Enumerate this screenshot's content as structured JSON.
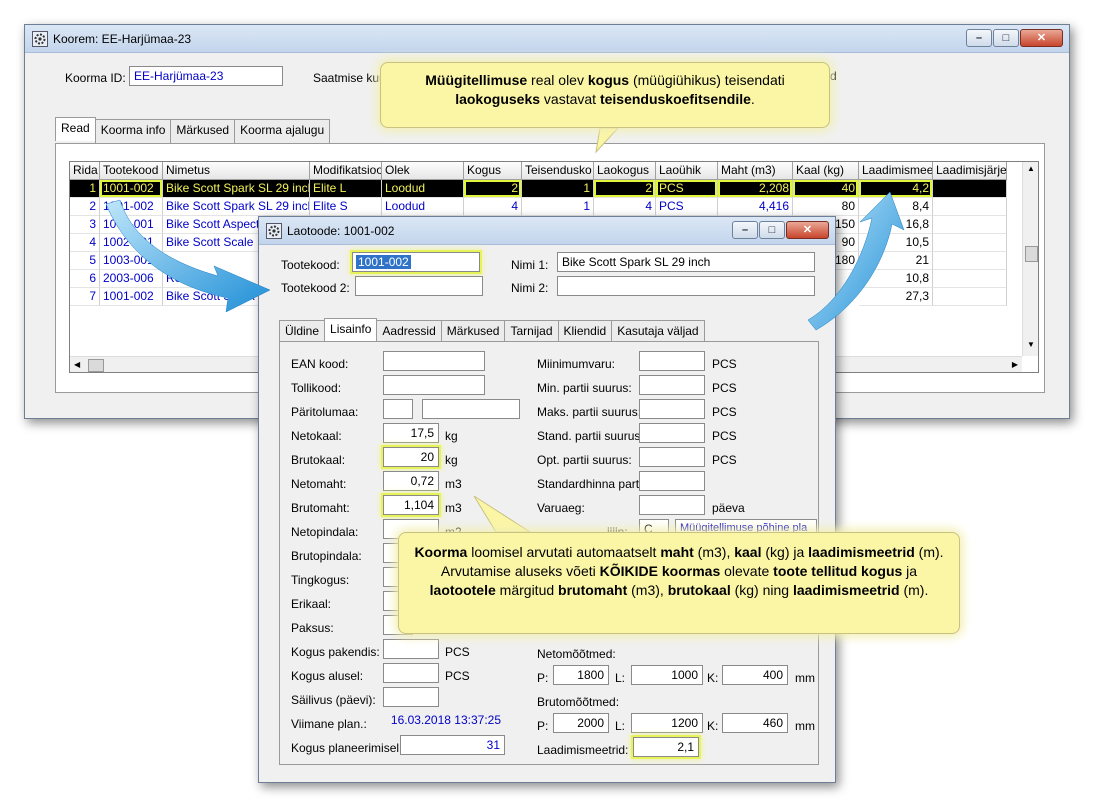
{
  "main": {
    "title": "Koorem: EE-Harjümaa-23",
    "id_label": "Koorma ID:",
    "id_value": "EE-Harjümaa-23",
    "saatmise_label": "Saatmise kuu",
    "truncated_right": "d",
    "tabs": [
      "Read",
      "Koorma info",
      "Märkused",
      "Koorma ajalugu"
    ],
    "grid": {
      "headers": [
        "Rida",
        "Tootekood",
        "Nimetus",
        "Modifikatsioo",
        "Olek",
        "Kogus",
        "Teisendusko",
        "Laokogus",
        "Laoühik",
        "Maht (m3)",
        "Kaal (kg)",
        "Laadimismee",
        "Laadimisjärjel"
      ],
      "rows": [
        [
          "1",
          "1001-002",
          "Bike Scott Spark SL 29 inch",
          "Elite L",
          "Loodud",
          "2",
          "1",
          "2",
          "PCS",
          "2,208",
          "40",
          "4,2"
        ],
        [
          "2",
          "1001-002",
          "Bike Scott Spark SL 29 inch",
          "Elite S",
          "Loodud",
          "4",
          "1",
          "4",
          "PCS",
          "4,416",
          "80",
          "8,4"
        ],
        [
          "3",
          "1004-001",
          "Bike Scott Aspect",
          "",
          "",
          "",
          "",
          "",
          "",
          "",
          "150",
          "16,8"
        ],
        [
          "4",
          "1002-001",
          "Bike Scott Scale",
          "",
          "",
          "",
          "",
          "",
          "",
          "",
          "90",
          "10,5"
        ],
        [
          "5",
          "1003-001",
          "",
          "",
          "",
          "",
          "",
          "",
          "",
          "",
          "180",
          "21"
        ],
        [
          "6",
          "2003-006",
          "Rear",
          "",
          "",
          "",
          "",
          "",
          "",
          "",
          "",
          "10,8"
        ],
        [
          "7",
          "1001-002",
          "Bike Scott Spark",
          "",
          "",
          "",
          "",
          "",
          "",
          "",
          "",
          "27,3"
        ]
      ]
    }
  },
  "detail": {
    "title": "Laotoode: 1001-002",
    "tootekood_label": "Tootekood:",
    "tootekood_value": "1001-002",
    "tootekood2_label": "Tootekood 2:",
    "nimi1_label": "Nimi 1:",
    "nimi1_value": "Bike Scott Spark SL 29 inch",
    "nimi2_label": "Nimi 2:",
    "tabs": [
      "Üldine",
      "Lisainfo",
      "Aadressid",
      "Märkused",
      "Tarnijad",
      "Kliendid",
      "Kasutaja väljad"
    ],
    "left_fields": [
      {
        "label": "EAN kood:",
        "value": "",
        "unit": ""
      },
      {
        "label": "Tollikood:",
        "value": "",
        "unit": ""
      },
      {
        "label": "Päritolumaa:",
        "value": "",
        "unit": ""
      },
      {
        "label": "Netokaal:",
        "value": "17,5",
        "unit": "kg"
      },
      {
        "label": "Brutokaal:",
        "value": "20",
        "unit": "kg"
      },
      {
        "label": "Netomaht:",
        "value": "0,72",
        "unit": "m3"
      },
      {
        "label": "Brutomaht:",
        "value": "1,104",
        "unit": "m3"
      },
      {
        "label": "Netopindala:",
        "value": "",
        "unit": "m2"
      },
      {
        "label": "Brutopindala:",
        "value": "",
        "unit": ""
      },
      {
        "label": "Tingkogus:",
        "value": "",
        "unit": ""
      },
      {
        "label": "Erikaal:",
        "value": "",
        "unit": ""
      },
      {
        "label": "Paksus:",
        "value": "",
        "unit": ""
      },
      {
        "label": "Kogus pakendis:",
        "value": "",
        "unit": "PCS"
      },
      {
        "label": "Kogus alusel:",
        "value": "",
        "unit": "PCS"
      },
      {
        "label": "Säilivus (päevi):",
        "value": "",
        "unit": ""
      },
      {
        "label": "Viimane plan.:",
        "value": "16.03.2018 13:37:25",
        "unit": ""
      },
      {
        "label": "Kogus planeerimisel:",
        "value": "31",
        "unit": ""
      }
    ],
    "right_fields": [
      {
        "label": "Miinimumvaru:",
        "unit": "PCS"
      },
      {
        "label": "Min. partii suurus:",
        "unit": "PCS"
      },
      {
        "label": "Maks. partii suurus:",
        "unit": "PCS"
      },
      {
        "label": "Stand. partii suurus:",
        "unit": "PCS"
      },
      {
        "label": "Opt. partii suurus:",
        "unit": "PCS"
      },
      {
        "label": "Standardhinna partii:",
        "unit": ""
      },
      {
        "label": "Varuaeg:",
        "unit": "päeva"
      }
    ],
    "plan_label_partial": "ijiin:",
    "plan_code": "C",
    "plan_desc": "Müügitellimuse põhine pla",
    "neto_label": "Netomõõtmed:",
    "bruto_label": "Brutomõõtmed:",
    "p_label": "P:",
    "l_label": "L:",
    "k_label": "K:",
    "mm": "mm",
    "neto": {
      "p": "1800",
      "l": "1000",
      "k": "400"
    },
    "bruto": {
      "p": "2000",
      "l": "1200",
      "k": "460"
    },
    "laadimis_label": "Laadimismeetrid:",
    "laadimis_value": "2,1"
  },
  "tooltip1_html": "<b>Müügitellimuse</b> real olev <b>kogus</b> (müügiühikus) teisendati <b>laokoguseks</b> vastavat <b>teisenduskoefitsendile</b>.",
  "tooltip2_html": "<b>Koorma</b> loomisel arvutati automaatselt <b>maht</b> (m3), <b>kaal</b> (kg) ja <b>laadimismeetrid</b> (m). Arvutamise aluseks võeti <b>KÕIKIDE koormas</b> olevate <b>toote tellitud kogus</b> ja <b>laotootele</b> märgitud <b>brutomaht</b> (m3), <b>brutokaal</b> (kg) ning <b>laadimismeetrid</b> (m).",
  "colors": {
    "accent_highlight": "#e8f35a",
    "tooltip_bg": "#fbf6a6",
    "arrow_blue": "#2a9fe0",
    "selected_row_bg": "#000000"
  }
}
